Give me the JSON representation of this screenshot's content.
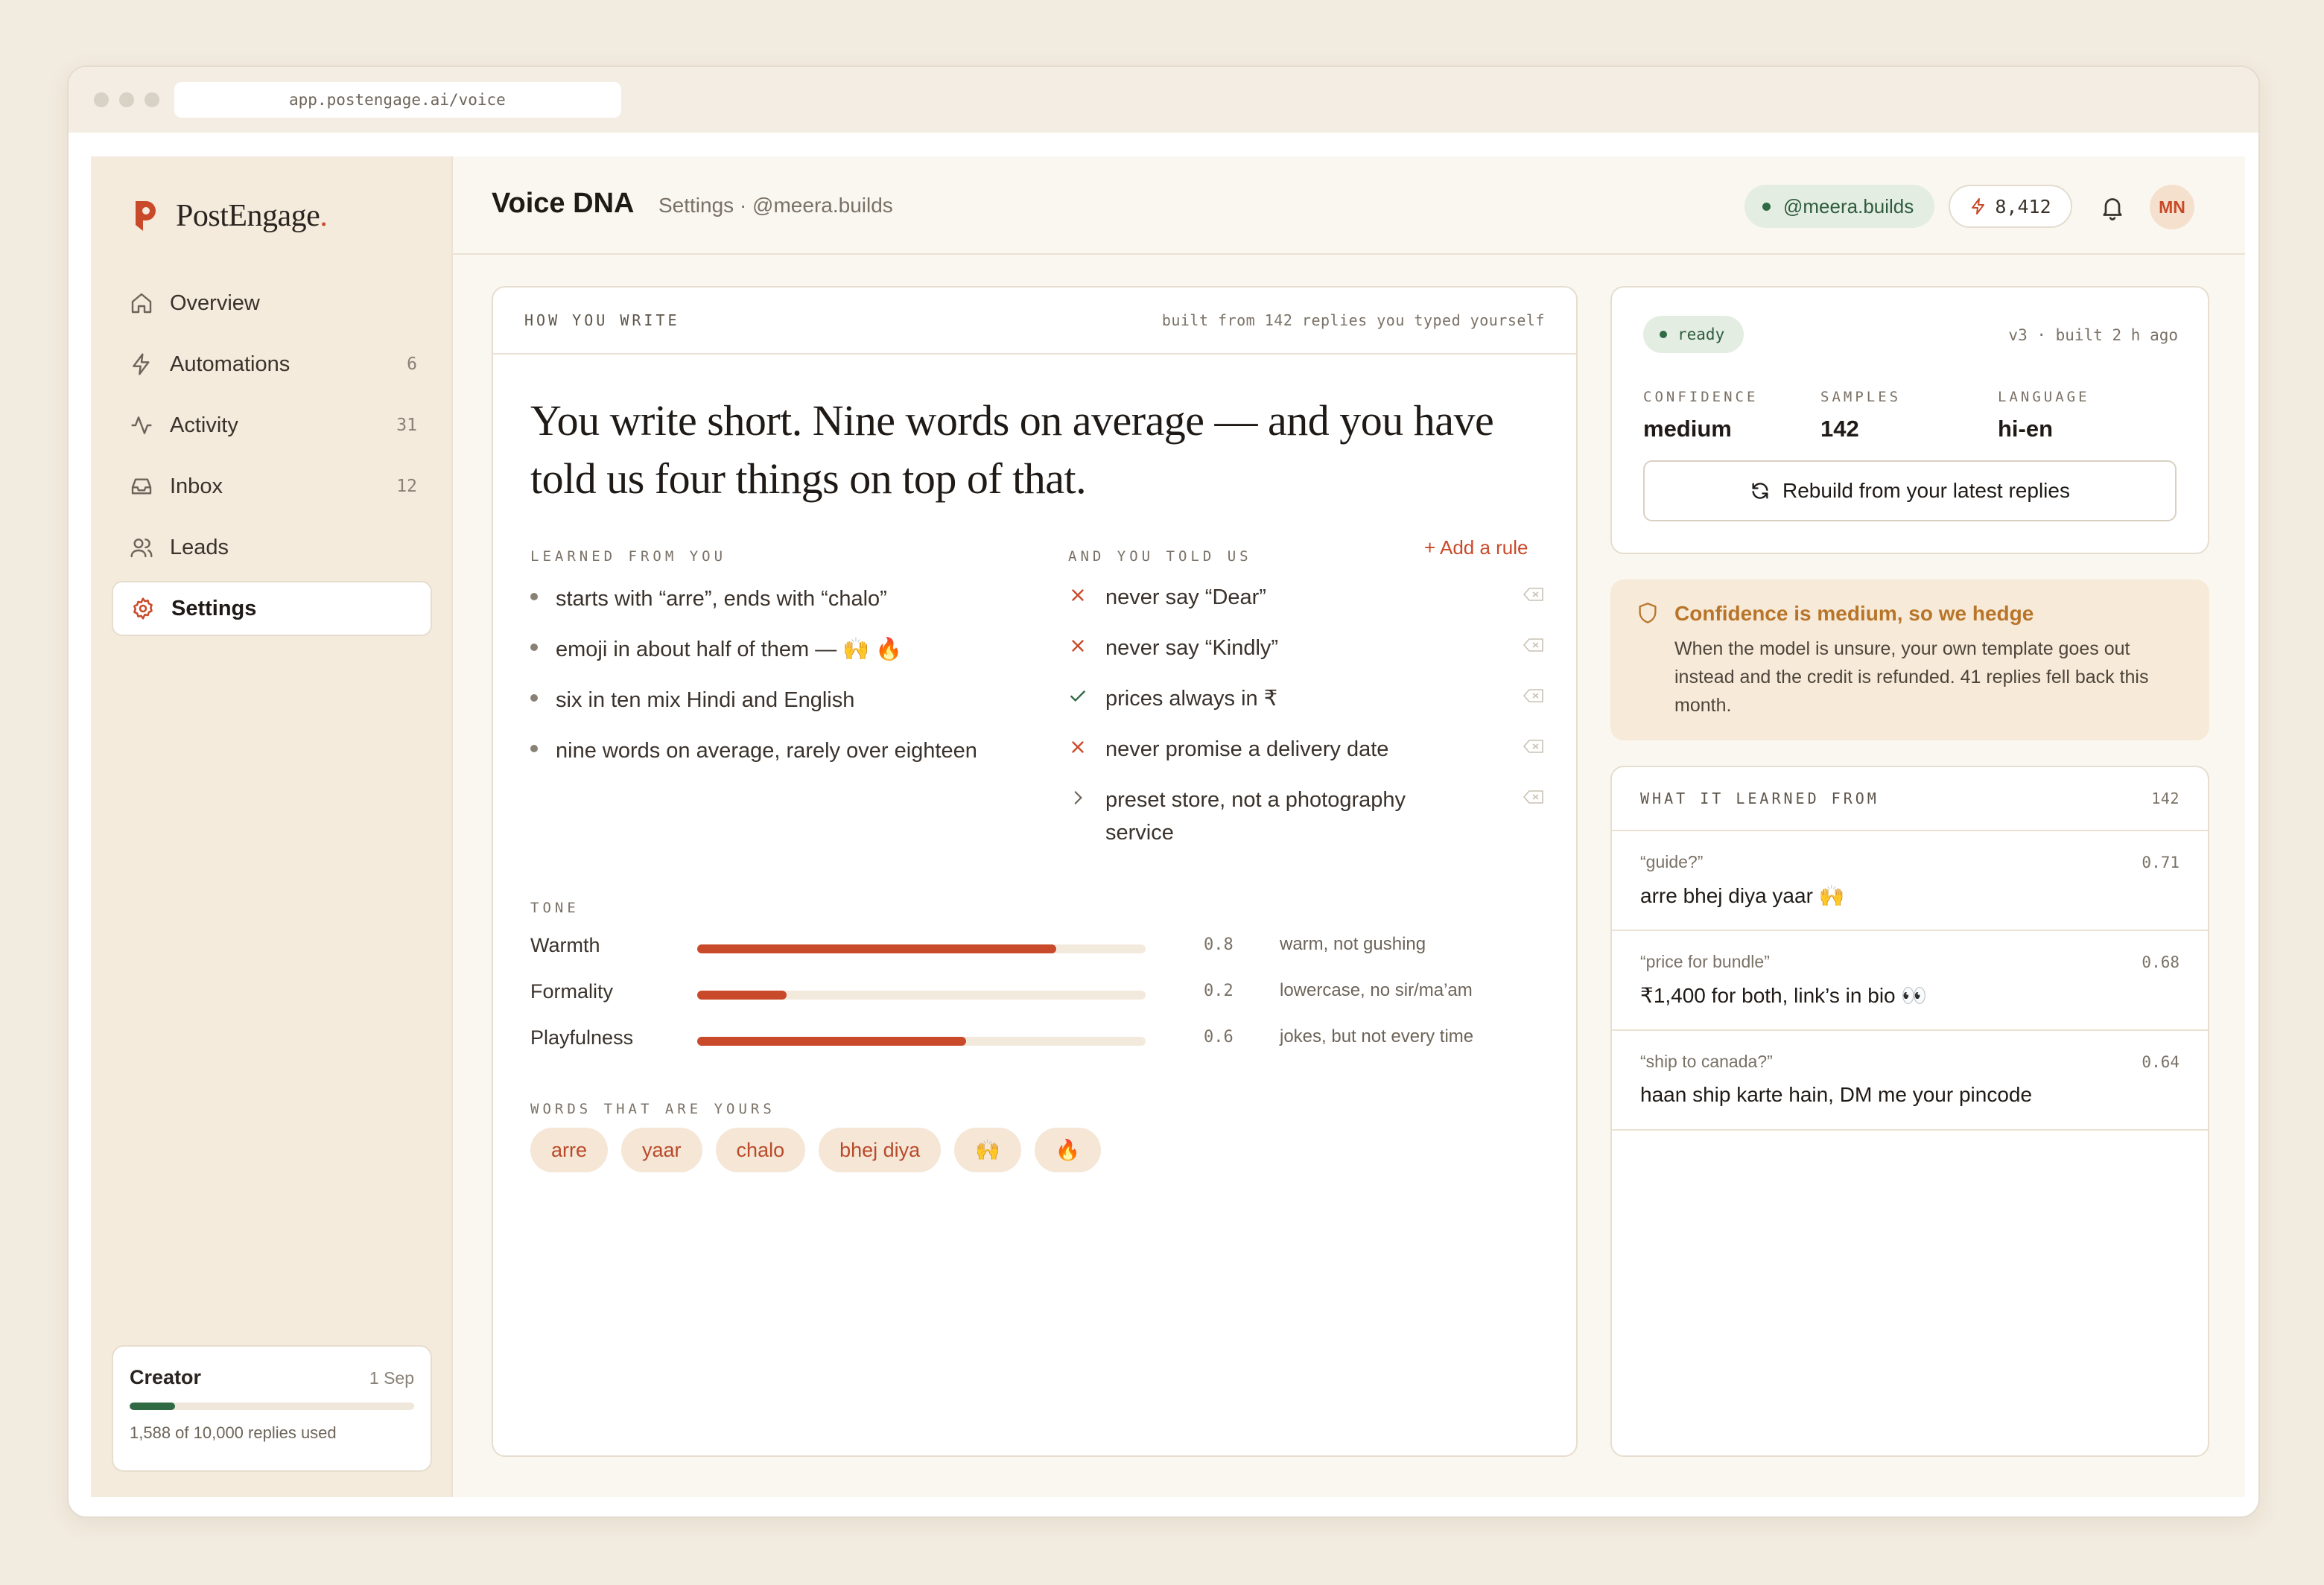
{
  "browser": {
    "url": "app.postengage.ai/voice"
  },
  "brand": {
    "name": "PostEngage",
    "dot": ".",
    "accent": "#c94a2a",
    "green": "#2f6a45"
  },
  "sidebar": {
    "items": [
      {
        "label": "Overview",
        "count": "",
        "icon": "home-icon"
      },
      {
        "label": "Automations",
        "count": "6",
        "icon": "bolt-icon"
      },
      {
        "label": "Activity",
        "count": "31",
        "icon": "activity-icon"
      },
      {
        "label": "Inbox",
        "count": "12",
        "icon": "inbox-icon"
      },
      {
        "label": "Leads",
        "count": "",
        "icon": "users-icon"
      },
      {
        "label": "Settings",
        "count": "",
        "icon": "gear-icon",
        "active": true
      }
    ],
    "plan": {
      "name": "Creator",
      "date": "1 Sep",
      "usage": "1,588 of 10,000 replies used",
      "used_fraction": 0.1588
    }
  },
  "header": {
    "title": "Voice DNA",
    "crumb": "Settings · @meera.builds",
    "handle": "@meera.builds",
    "credits": "8,412",
    "avatar": "MN"
  },
  "main": {
    "head_label": "HOW YOU WRITE",
    "head_meta": "built from 142 replies you typed yourself",
    "headline": "You write short. Nine words on average — and you have told us four things on top of that.",
    "learned_label": "LEARNED FROM YOU",
    "learned": [
      "starts with “arre”, ends with “chalo”",
      "emoji in about half of them — 🙌 🔥",
      "six in ten mix Hindi and English",
      "nine words on average, rarely over eighteen"
    ],
    "rules_label": "AND YOU TOLD US",
    "add_rule": "+ Add a rule",
    "rules": [
      {
        "text": "never say “Dear”",
        "kind": "never"
      },
      {
        "text": "never say “Kindly”",
        "kind": "never"
      },
      {
        "text": "prices always in ₹",
        "kind": "always"
      },
      {
        "text": "never promise a delivery date",
        "kind": "never"
      },
      {
        "text": "preset store, not a photography service",
        "kind": "context"
      }
    ],
    "tone_label": "TONE",
    "tone": [
      {
        "label": "Warmth",
        "value": 0.8,
        "display": "0.8",
        "note": "warm, not gushing"
      },
      {
        "label": "Formality",
        "value": 0.2,
        "display": "0.2",
        "note": "lowercase, no sir/ma’am"
      },
      {
        "label": "Playfulness",
        "value": 0.6,
        "display": "0.6",
        "note": "jokes, but not every time"
      }
    ],
    "words_label": "WORDS THAT ARE YOURS",
    "words": [
      "arre",
      "yaar",
      "chalo",
      "bhej diya",
      "🙌",
      "🔥"
    ]
  },
  "status": {
    "state": "ready",
    "version": "v3 · built 2 h ago",
    "confidence_label": "CONFIDENCE",
    "confidence": "medium",
    "samples_label": "SAMPLES",
    "samples": "142",
    "language_label": "LANGUAGE",
    "language": "hi-en",
    "rebuild": "Rebuild from your latest replies"
  },
  "hedge": {
    "title": "Confidence is medium, so we hedge",
    "body": "When the model is unsure, your own template goes out instead and the credit is refunded. 41 replies fell back this month."
  },
  "samples": {
    "label": "WHAT IT LEARNED FROM",
    "count": "142",
    "items": [
      {
        "q": "“guide?”",
        "a": "arre bhej diya yaar 🙌",
        "score": "0.71"
      },
      {
        "q": "“price for bundle”",
        "a": "₹1,400 for both, link’s in bio 👀",
        "score": "0.68"
      },
      {
        "q": "“ship to canada?”",
        "a": "haan ship karte hain, DM me your pincode",
        "score": "0.64"
      }
    ]
  }
}
